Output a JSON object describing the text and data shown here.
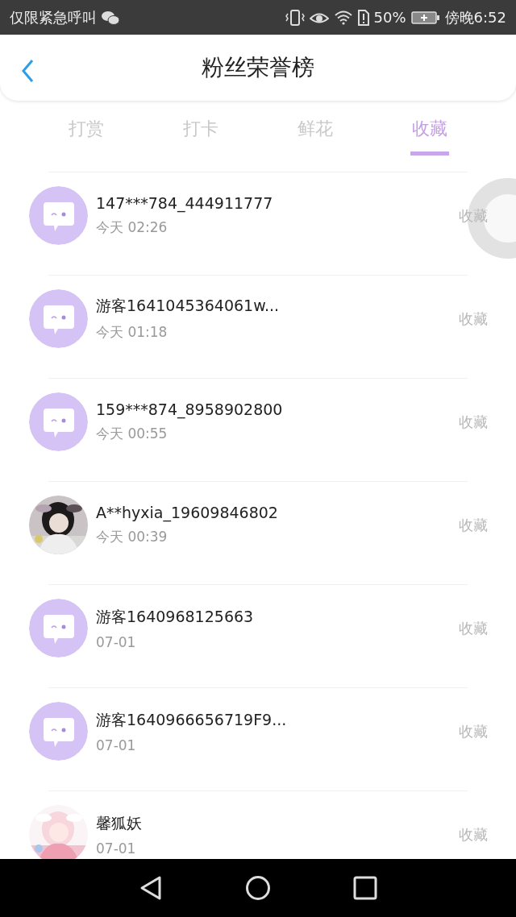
{
  "status_bar": {
    "carrier": "仅限紧急呼叫",
    "battery_percent": "50%",
    "time": "傍晚6:52"
  },
  "header": {
    "title": "粉丝荣誉榜"
  },
  "tabs": [
    {
      "label": "打赏",
      "selected": false
    },
    {
      "label": "打卡",
      "selected": false
    },
    {
      "label": "鲜花",
      "selected": false
    },
    {
      "label": "收藏",
      "selected": true
    }
  ],
  "fans": [
    {
      "name": "147***784_444911777",
      "time": "今天 02:26",
      "action": "收藏",
      "avatar": {
        "kind": "default"
      }
    },
    {
      "name": "游客1641045364061w...",
      "time": "今天 01:18",
      "action": "收藏",
      "avatar": {
        "kind": "default"
      }
    },
    {
      "name": "159***874_8958902800",
      "time": "今天 00:55",
      "action": "收藏",
      "avatar": {
        "kind": "default"
      }
    },
    {
      "name": "A**hyxia_19609846802",
      "time": "今天 00:39",
      "action": "收藏"
    },
    {
      "name": "游客1640968125663",
      "time": "07-01",
      "action": "收藏",
      "avatar": {
        "kind": "default"
      }
    },
    {
      "name": "游客1640966656719F9...",
      "time": "07-01",
      "action": "收藏",
      "avatar": {
        "kind": "default"
      }
    },
    {
      "name": "馨狐妖",
      "time": "07-01",
      "action": "收藏"
    }
  ]
}
